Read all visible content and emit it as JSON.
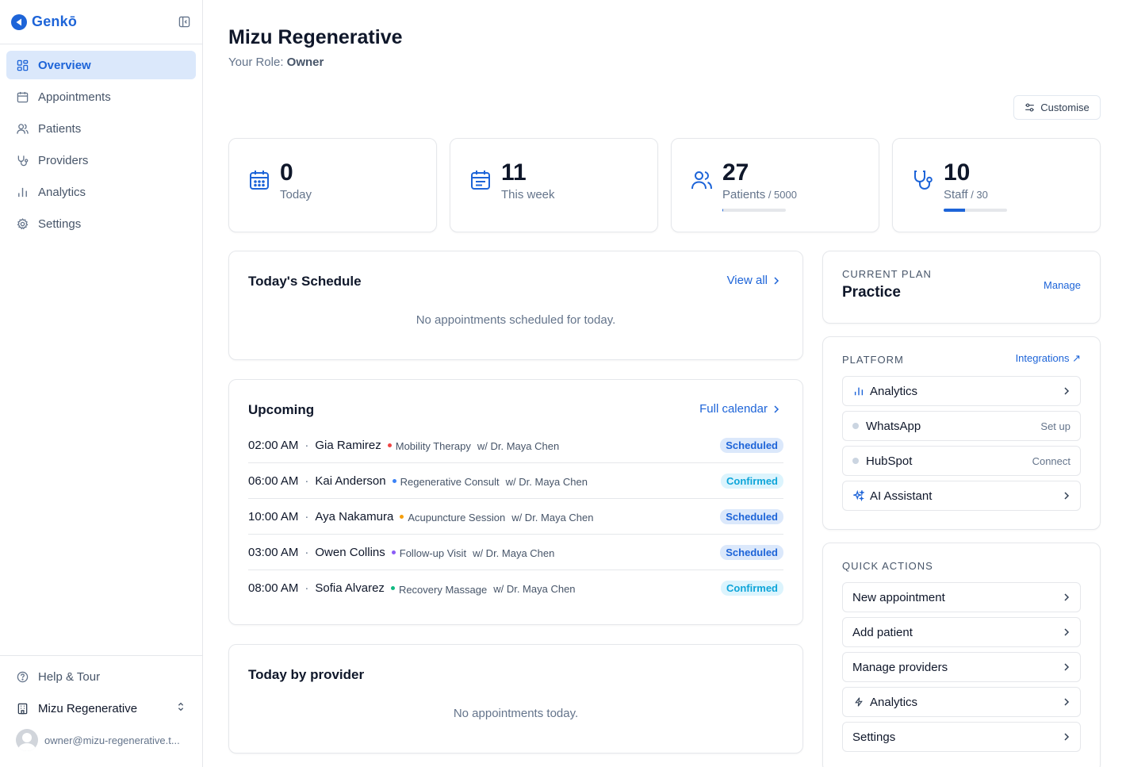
{
  "brand": {
    "name": "Genkō"
  },
  "nav": [
    {
      "key": "overview",
      "label": "Overview",
      "icon": "grid-icon",
      "active": true
    },
    {
      "key": "appointments",
      "label": "Appointments",
      "icon": "calendar-icon",
      "active": false
    },
    {
      "key": "patients",
      "label": "Patients",
      "icon": "users-icon",
      "active": false
    },
    {
      "key": "providers",
      "label": "Providers",
      "icon": "stethoscope-icon",
      "active": false
    },
    {
      "key": "analytics",
      "label": "Analytics",
      "icon": "bar-chart-icon",
      "active": false
    },
    {
      "key": "settings",
      "label": "Settings",
      "icon": "gear-icon",
      "active": false
    }
  ],
  "sidebar_bottom": {
    "help": "Help & Tour",
    "org": "Mizu Regenerative",
    "user_email": "owner@mizu-regenerative.t..."
  },
  "header": {
    "title": "Mizu Regenerative",
    "role_prefix": "Your Role: ",
    "role": "Owner",
    "customise": "Customise"
  },
  "stats": {
    "today": {
      "value": "0",
      "label": "Today"
    },
    "week": {
      "value": "11",
      "label": "This week"
    },
    "patients": {
      "value": "27",
      "label": "Patients",
      "limit": " / 5000",
      "progress": 0.0054
    },
    "staff": {
      "value": "10",
      "label": "Staff",
      "limit": " / 30",
      "progress": 0.3333
    }
  },
  "schedule": {
    "title": "Today's Schedule",
    "link": "View all",
    "empty": "No appointments scheduled for today."
  },
  "upcoming": {
    "title": "Upcoming",
    "link": "Full calendar",
    "items": [
      {
        "time": "02:00 AM",
        "patient": "Gia Ramirez",
        "service": "Mobility Therapy",
        "dot": "#ef4444",
        "provider": "w/ Dr. Maya Chen",
        "status": "Scheduled",
        "status_type": "scheduled"
      },
      {
        "time": "06:00 AM",
        "patient": "Kai Anderson",
        "service": "Regenerative Consult",
        "dot": "#3b82f6",
        "provider": "w/ Dr. Maya Chen",
        "status": "Confirmed",
        "status_type": "confirmed"
      },
      {
        "time": "10:00 AM",
        "patient": "Aya Nakamura",
        "service": "Acupuncture Session",
        "dot": "#f59e0b",
        "provider": "w/ Dr. Maya Chen",
        "status": "Scheduled",
        "status_type": "scheduled"
      },
      {
        "time": "03:00 AM",
        "patient": "Owen Collins",
        "service": "Follow-up Visit",
        "dot": "#8b5cf6",
        "provider": "w/ Dr. Maya Chen",
        "status": "Scheduled",
        "status_type": "scheduled"
      },
      {
        "time": "08:00 AM",
        "patient": "Sofia Alvarez",
        "service": "Recovery Massage",
        "dot": "#10b981",
        "provider": "w/ Dr. Maya Chen",
        "status": "Confirmed",
        "status_type": "confirmed"
      }
    ]
  },
  "by_provider": {
    "title": "Today by provider",
    "empty": "No appointments today."
  },
  "plan": {
    "label": "CURRENT PLAN",
    "name": "Practice",
    "manage": "Manage"
  },
  "platform": {
    "label": "PLATFORM",
    "link": "Integrations ↗",
    "items": [
      {
        "label": "Analytics",
        "icon": "bar-chart-icon",
        "right": ""
      },
      {
        "label": "WhatsApp",
        "icon": "status-dot-icon",
        "right": "Set up"
      },
      {
        "label": "HubSpot",
        "icon": "status-dot-icon",
        "right": "Connect"
      },
      {
        "label": "AI Assistant",
        "icon": "sparkles-icon",
        "right": ""
      }
    ]
  },
  "quick_actions": {
    "label": "QUICK ACTIONS",
    "items": [
      {
        "label": "New appointment"
      },
      {
        "label": "Add patient"
      },
      {
        "label": "Manage providers"
      },
      {
        "label": "Analytics",
        "icon": "zap-icon"
      },
      {
        "label": "Settings"
      }
    ]
  },
  "colors": {
    "primary": "#1d64d8",
    "active_bg": "#dbe8fb",
    "confirmed": "#0ea5d9"
  }
}
